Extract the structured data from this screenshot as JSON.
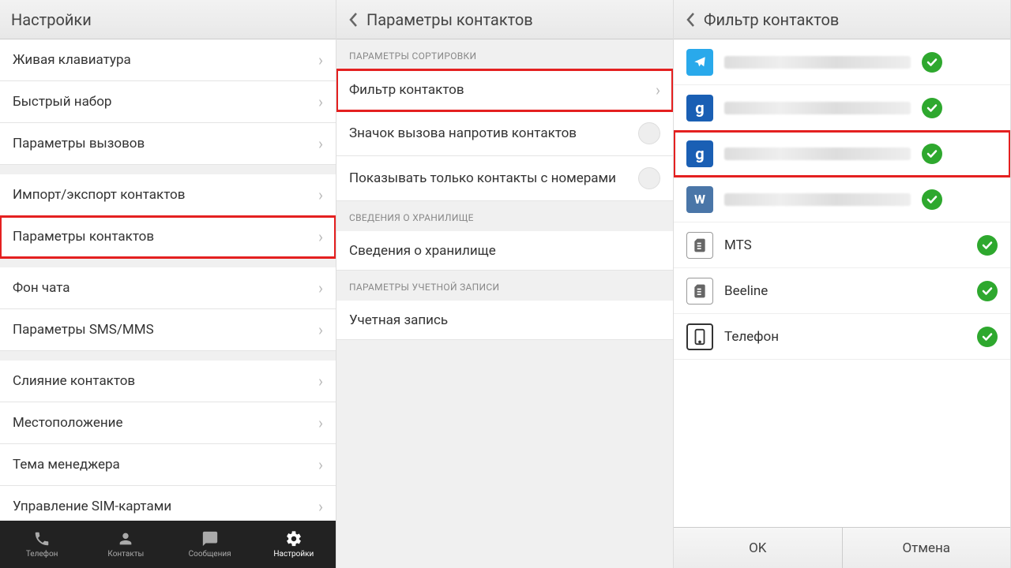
{
  "panel1": {
    "title": "Настройки",
    "groups": [
      [
        "Живая клавиатура",
        "Быстрый набор",
        "Параметры вызовов"
      ],
      [
        "Импорт/экспорт контактов",
        "Параметры контактов"
      ],
      [
        "Фон чата",
        "Параметры SMS/MMS"
      ],
      [
        "Слияние контактов",
        "Местоположение",
        "Тема менеджера",
        "Управление SIM-картами"
      ]
    ],
    "highlight": "Параметры контактов",
    "nav": [
      "Телефон",
      "Контакты",
      "Сообщения",
      "Настройки"
    ]
  },
  "panel2": {
    "title": "Параметры контактов",
    "sections": [
      {
        "label": "ПАРАМЕТРЫ СОРТИРОВКИ",
        "rows": [
          {
            "text": "Фильтр контактов",
            "type": "nav",
            "highlight": true
          },
          {
            "text": "Значок вызова напротив контактов",
            "type": "toggle"
          },
          {
            "text": "Показывать только контакты с номерами",
            "type": "toggle"
          }
        ]
      },
      {
        "label": "СВЕДЕНИЯ О ХРАНИЛИЩЕ",
        "rows": [
          {
            "text": "Сведения о хранилище",
            "type": "plain"
          }
        ]
      },
      {
        "label": "ПАРАМЕТРЫ УЧЕТНОЙ ЗАПИСИ",
        "rows": [
          {
            "text": "Учетная запись",
            "type": "plain"
          }
        ]
      }
    ]
  },
  "panel3": {
    "title": "Фильтр контактов",
    "items": [
      {
        "icon": "telegram",
        "label": "",
        "blurred": true,
        "checked": true
      },
      {
        "icon": "google",
        "label": "",
        "blurred": true,
        "checked": true
      },
      {
        "icon": "google",
        "label": "",
        "blurred": true,
        "checked": true,
        "highlight": true
      },
      {
        "icon": "vk",
        "label": "",
        "blurred": true,
        "checked": true
      },
      {
        "icon": "sim",
        "label": "MTS",
        "blurred": false,
        "checked": true
      },
      {
        "icon": "sim",
        "label": "Beeline",
        "blurred": false,
        "checked": true
      },
      {
        "icon": "phone",
        "label": "Телефон",
        "blurred": false,
        "checked": true
      }
    ],
    "buttons": {
      "ok": "OK",
      "cancel": "Отмена"
    }
  }
}
